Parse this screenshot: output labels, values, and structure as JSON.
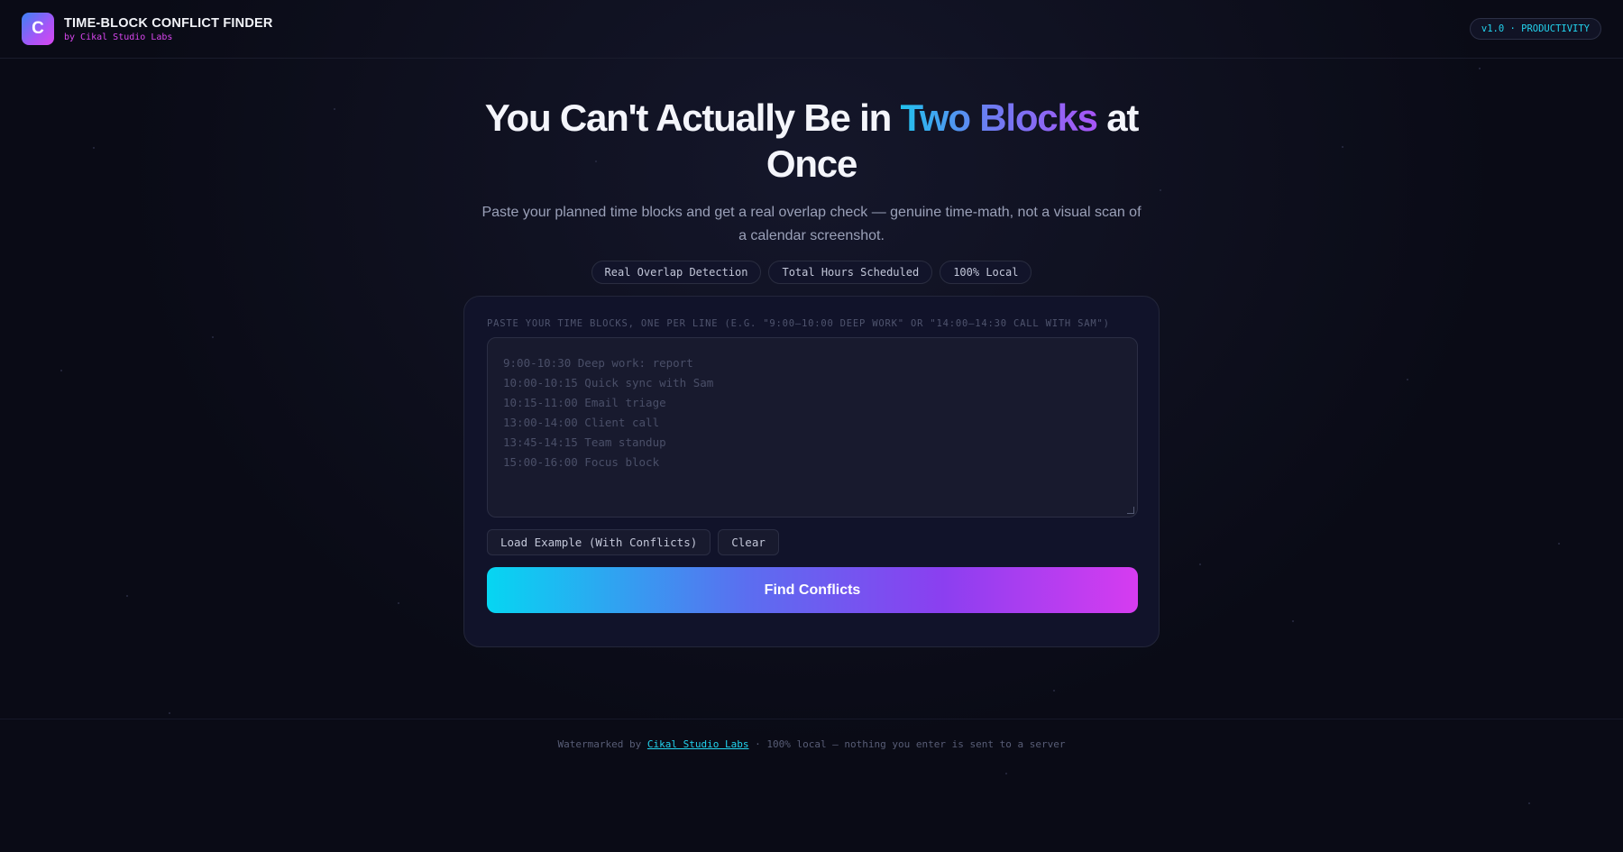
{
  "header": {
    "logo_letter": "C",
    "title": "TIME-BLOCK CONFLICT FINDER",
    "subtitle": "by Cikal Studio Labs",
    "version_badge": "v1.0 · PRODUCTIVITY"
  },
  "hero": {
    "title_before": "You Can't Actually Be in ",
    "title_highlight": "Two Blocks",
    "title_after": " at Once",
    "description": "Paste your planned time blocks and get a real overlap check — genuine time-math, not a visual scan of a calendar screenshot.",
    "chips": [
      "Real Overlap Detection",
      "Total Hours Scheduled",
      "100% Local"
    ]
  },
  "form": {
    "label": "Paste your time blocks, one per line (e.g. \"9:00–10:00 Deep work\" or \"14:00–14:30 Call with Sam\")",
    "textarea_value": "",
    "placeholder_lines": [
      "9:00-10:30 Deep work: report",
      "10:00-10:15 Quick sync with Sam",
      "10:15-11:00 Email triage",
      "13:00-14:00 Client call",
      "13:45-14:15 Team standup",
      "15:00-16:00 Focus block"
    ],
    "load_example_label": "Load Example (With Conflicts)",
    "clear_label": "Clear",
    "submit_label": "Find Conflicts"
  },
  "footer": {
    "prefix": "Watermarked by ",
    "link_text": "Cikal Studio Labs",
    "suffix": " · 100% local — nothing you enter is sent to a server"
  },
  "colors": {
    "background": "#0a0b16",
    "accent_cyan": "#22d3ee",
    "accent_magenta": "#d946ef",
    "accent_purple": "#a855f7"
  }
}
